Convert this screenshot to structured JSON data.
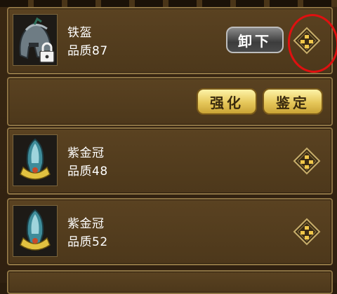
{
  "items": [
    {
      "name": "铁盔",
      "quality": "品质87"
    },
    {
      "name": "紫金冠",
      "quality": "品质48"
    },
    {
      "name": "紫金冠",
      "quality": "品质52"
    }
  ],
  "actions": {
    "unequip_label": "卸下",
    "strengthen_label": "强化",
    "identify_label": "鉴定"
  },
  "icons": {
    "equipped_item": "iron-helmet-icon",
    "list_items": "purple-gold-crown-icon",
    "lock": "lock-icon",
    "detail": "diamond-detail-icon"
  },
  "colors": {
    "panel": "#5a4221",
    "panel_border": "#8e7444",
    "highlight_circle": "#e01010",
    "yellow_button": "#e6c75a",
    "grey_button": "#4a4a4a"
  }
}
